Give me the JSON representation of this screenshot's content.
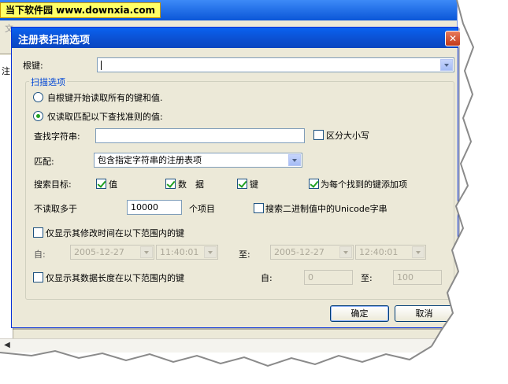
{
  "watermark": {
    "text": "当下软件园 www.downxia.com"
  },
  "background": {
    "menu_fragment": "文",
    "content_fragment": "注"
  },
  "dialog": {
    "title": "注册表扫描选项",
    "root_key_label": "根键:",
    "root_key_value": "",
    "scan_group_label": "扫描选项",
    "radio_all_label": "自根键开始读取所有的键和值.",
    "radio_match_label": "仅读取匹配以下查找准则的值:",
    "find_string_label": "查找字符串:",
    "find_string_value": "",
    "case_sensitive_label": "区分大小写",
    "match_label": "匹配:",
    "match_value": "包含指定字符串的注册表项",
    "search_target_label": "搜索目标:",
    "target_value_label": "值",
    "target_data_label": "数　据",
    "target_key_label": "键",
    "add_each_key_label": "为每个找到的键添加项",
    "max_read_label": "不读取多于",
    "max_read_value": "10000",
    "max_read_unit": "个项目",
    "unicode_label": "搜索二进制值中的Unicode字串",
    "modified_time_label": "仅显示其修改时间在以下范围内的键",
    "from_label": "自:",
    "to_label": "至:",
    "date_from": "2005-12-27",
    "time_from": "11:40:01",
    "date_to": "2005-12-27",
    "time_to": "12:40:01",
    "data_length_label": "仅显示其数据长度在以下范围内的键",
    "length_from_label": "自:",
    "length_to_label": "至:",
    "length_from_value": "0",
    "length_to_value": "100",
    "ok_label": "确定",
    "cancel_label": "取消",
    "close_glyph": "✕"
  },
  "state": {
    "radio_all": false,
    "radio_match": true,
    "case_sensitive": false,
    "target_value": true,
    "target_data": true,
    "target_key": true,
    "add_each_key": true,
    "unicode": false,
    "modified_time": false,
    "data_length": false
  },
  "colors": {
    "title_bar": "#0a56d8",
    "dialog_bg": "#ece9d8",
    "group_label": "#0046d5",
    "check_mark": "#21a121"
  }
}
